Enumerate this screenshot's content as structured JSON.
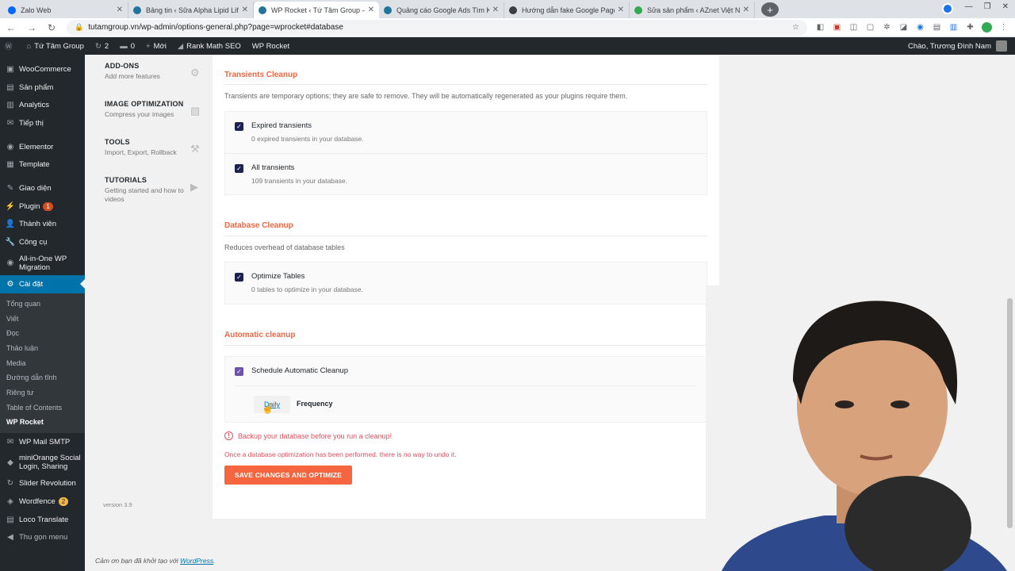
{
  "browser": {
    "tabs": [
      {
        "label": "Zalo Web",
        "color": "#0068ff",
        "active": false
      },
      {
        "label": "Bảng tin ‹ Sữa Alpha Lipid Lifeline",
        "color": "#21759b",
        "active": false
      },
      {
        "label": "WP Rocket ‹ Tứ Tâm Group — W",
        "color": "#21759b",
        "active": true
      },
      {
        "label": "Quảng cáo Google Ads Tìm Kiếm",
        "color": "#21759b",
        "active": false
      },
      {
        "label": "Hướng dẫn fake Google Page Sp",
        "color": "#3c4043",
        "active": false
      },
      {
        "label": "Sửa sản phẩm ‹ AZnet Việt Nam",
        "color": "#34a853",
        "active": false
      }
    ],
    "tab_close": "✕",
    "new_tab": "+",
    "window_controls": [
      "—",
      "❐",
      "✕"
    ],
    "url": "tutamgroup.vn/wp-admin/options-general.php?page=wprocket#database",
    "nav": {
      "back": "←",
      "forward": "→",
      "reload": "↻"
    },
    "star": "☆"
  },
  "adminbar": {
    "site_name": "Tứ Tâm Group",
    "updates": "2",
    "comments": "0",
    "new": "Mới",
    "rank_math": "Rank Math SEO",
    "wp_rocket": "WP Rocket",
    "greeting": "Chào, Trương Đình Nam"
  },
  "sidebar": {
    "items_top": [
      {
        "label": "WooCommerce",
        "icon": "woo-icon",
        "glyph": "▣"
      },
      {
        "label": "Sản phẩm",
        "icon": "products-icon",
        "glyph": "▤"
      },
      {
        "label": "Analytics",
        "icon": "analytics-icon",
        "glyph": "▥"
      },
      {
        "label": "Tiếp thị",
        "icon": "marketing-icon",
        "glyph": "✉"
      }
    ],
    "items_mid": [
      {
        "label": "Elementor",
        "icon": "elementor-icon",
        "glyph": "◉"
      },
      {
        "label": "Template",
        "icon": "template-icon",
        "glyph": "▦"
      }
    ],
    "appearance": "Giao diện",
    "plugins": "Plugin",
    "plugins_badge": "1",
    "users": "Thành viên",
    "tools": "Công cụ",
    "migration": "All-in-One WP Migration",
    "settings": "Cài đặt",
    "sub": [
      "Tổng quan",
      "Viết",
      "Đọc",
      "Thảo luận",
      "Media",
      "Đường dẫn tĩnh",
      "Riêng tư",
      "Table of Contents",
      "WP Rocket"
    ],
    "mail_smtp": "WP Mail SMTP",
    "miniorange": "miniOrange Social Login, Sharing",
    "slider": "Slider Revolution",
    "wordfence": "Wordfence",
    "wordfence_badge": "2",
    "loco": "Loco Translate",
    "collapse": "Thu gọn menu"
  },
  "rocket_nav": [
    {
      "title": "ADD-ONS",
      "desc": "Add more features",
      "icon": "addons-icon",
      "glyph": "⚙"
    },
    {
      "title": "IMAGE OPTIMIZATION",
      "desc": "Compress your images",
      "icon": "image-icon",
      "glyph": "▨"
    },
    {
      "title": "TOOLS",
      "desc": "Import, Export, Rollback",
      "icon": "tools-icon",
      "glyph": "⚒"
    },
    {
      "title": "TUTORIALS",
      "desc": "Getting started and how to videos",
      "icon": "video-icon",
      "glyph": "▶"
    }
  ],
  "version": "version 3.9",
  "transients": {
    "title": "Transients Cleanup",
    "desc": "Transients are temporary options; they are safe to remove. They will be automatically regenerated as your plugins require them.",
    "options": [
      {
        "label": "Expired transients",
        "desc": "0 expired transients in your database."
      },
      {
        "label": "All transients",
        "desc": "109 transients in your database."
      }
    ]
  },
  "database": {
    "title": "Database Cleanup",
    "desc": "Reduces overhead of database tables",
    "options": [
      {
        "label": "Optimize Tables",
        "desc": "0 tables to optimize in your database."
      }
    ]
  },
  "automatic": {
    "title": "Automatic cleanup",
    "schedule_label": "Schedule Automatic Cleanup",
    "frequency_value": "Daily",
    "frequency_label": "Frequency"
  },
  "warning": "Backup your database before you run a cleanup!",
  "warning_note": "Once a database optimization has been performed, there is no way to undo it.",
  "save_button": "SAVE CHANGES AND OPTIMIZE",
  "footer": {
    "text": "Cảm ơn bạn đã khởi tạo với ",
    "link": "WordPress",
    "end": "."
  },
  "check": "✓"
}
